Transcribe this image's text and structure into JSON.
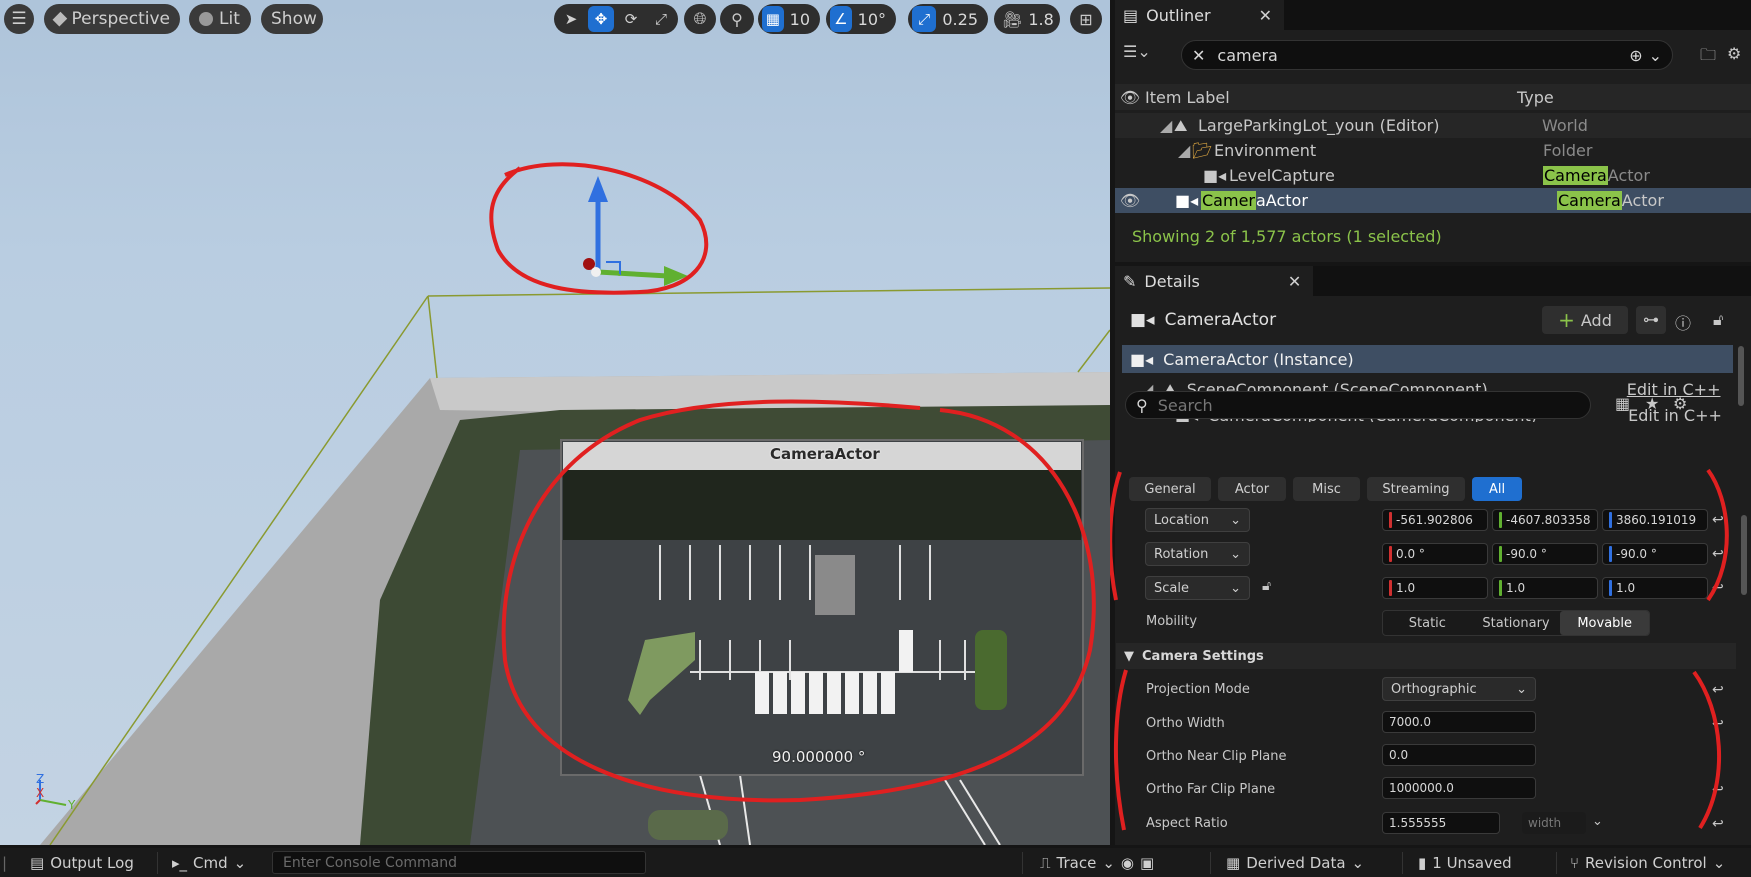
{
  "viewport": {
    "menu_icon": "hamburger-icon",
    "perspective_label": "Perspective",
    "lit_label": "Lit",
    "show_label": "Show",
    "grid_value": "10",
    "angle_value": "10°",
    "scale_snap_value": "0.25",
    "camera_speed_value": "1.8",
    "pip_title": "CameraActor",
    "pip_angle": "90.000000 °",
    "axis_z": "Z",
    "axis_x": "X",
    "axis_y": "Y"
  },
  "outliner": {
    "tab_label": "Outliner",
    "search_value": "camera",
    "col_label": "Item Label",
    "col_type": "Type",
    "rows": [
      {
        "label": "LargeParkingLot_youn (Editor)",
        "type": "World"
      },
      {
        "label": "Environment",
        "type": "Folder"
      },
      {
        "label": "LevelCapture",
        "type_hl": "Camera",
        "type_rest": "Actor"
      },
      {
        "label_hl": "Camer",
        "label_rest": "aActor",
        "type_hl": "Camera",
        "type_rest": "Actor"
      }
    ],
    "status": "Showing 2 of 1,577 actors (1 selected)"
  },
  "details": {
    "tab_label": "Details",
    "actor_name": "CameraActor",
    "add_label": "Add",
    "instance_label": "CameraActor (Instance)",
    "components": [
      {
        "label": "SceneComponent (SceneComponent)",
        "link": "Edit in C++"
      },
      {
        "label": "CameraComponent (CameraComponent)",
        "link": "Edit in C++"
      }
    ],
    "search_placeholder": "Search",
    "filters": [
      "General",
      "Actor",
      "Misc",
      "Streaming",
      "All"
    ],
    "transform": {
      "location_label": "Location",
      "location": [
        "-561.902806",
        "-4607.803358",
        "3860.191019"
      ],
      "rotation_label": "Rotation",
      "rotation": [
        "0.0 °",
        "-90.0 °",
        "-90.0 °"
      ],
      "scale_label": "Scale",
      "scale": [
        "1.0",
        "1.0",
        "1.0"
      ]
    },
    "mobility_label": "Mobility",
    "mobility_options": [
      "Static",
      "Stationary",
      "Movable"
    ],
    "section_camera": "Camera Settings",
    "projection_label": "Projection Mode",
    "projection_value": "Orthographic",
    "ortho_width_label": "Ortho Width",
    "ortho_width": "7000.0",
    "near_label": "Ortho Near Clip Plane",
    "near_value": "0.0",
    "far_label": "Ortho Far Clip Plane",
    "far_value": "1000000.0",
    "aspect_label": "Aspect Ratio",
    "aspect_value": "1.555555",
    "aspect_extra_placeholder": "width"
  },
  "statusbar": {
    "output_log": "Output Log",
    "cmd": "Cmd",
    "console_placeholder": "Enter Console Command",
    "trace": "Trace",
    "derived_data": "Derived Data",
    "unsaved": "1 Unsaved",
    "revision_control": "Revision Control"
  },
  "colors": {
    "accent_blue": "#1f6fd0",
    "highlight_green": "#8bc34a",
    "annotation_red": "#e02020",
    "axis_x": "#d03030",
    "axis_y": "#60b030",
    "axis_z": "#3070e0"
  }
}
